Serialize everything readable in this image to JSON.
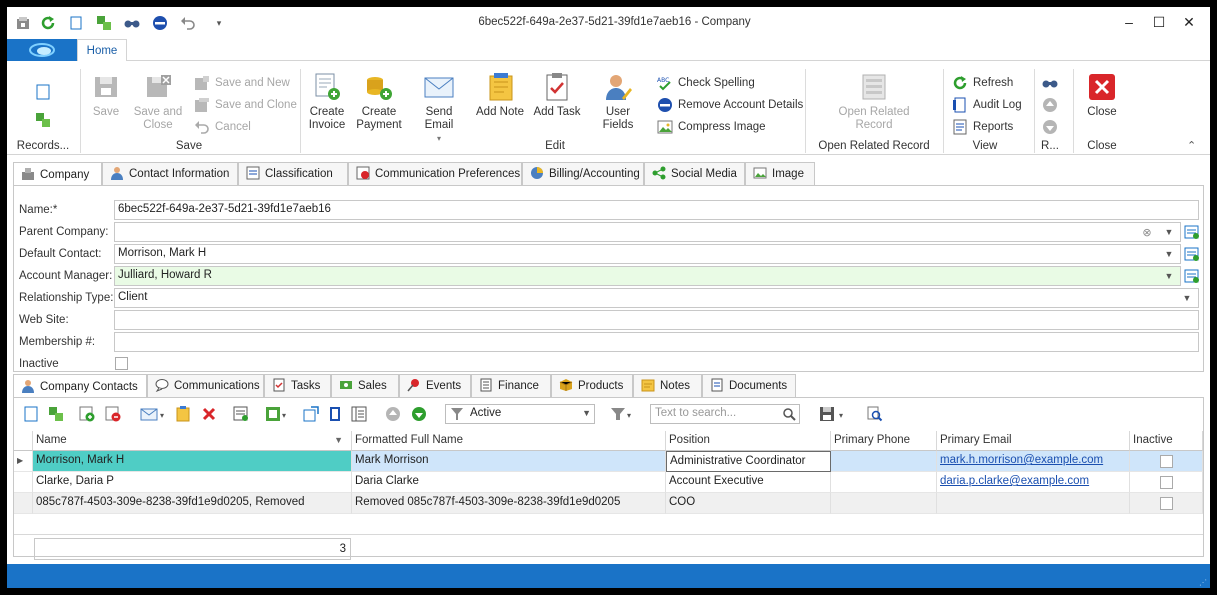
{
  "window": {
    "title": "6bec522f-649a-2e37-5d21-39fd1e7aeb16 - Company",
    "qat_icons": [
      "save-icon",
      "refresh-icon",
      "new-icon",
      "add-green-icon",
      "binoculars-icon",
      "remove-icon",
      "undo-icon",
      "customize-icon"
    ],
    "minimize": "–",
    "maximize": "☐",
    "close": "✕"
  },
  "ribbon": {
    "tab_home": "Home",
    "groups": {
      "records": "Records...",
      "save": "Save",
      "edit": "Edit",
      "open_related": "Open Related Record",
      "view": "View",
      "r": "R...",
      "close": "Close"
    },
    "buttons": {
      "save": "Save",
      "save_and_close_1": "Save and",
      "save_and_close_2": "Close",
      "save_and_new": "Save and New",
      "save_and_clone": "Save and Clone",
      "cancel": "Cancel",
      "create_invoice_1": "Create",
      "create_invoice_2": "Invoice",
      "create_payment_1": "Create",
      "create_payment_2": "Payment",
      "send_email": "Send Email",
      "add_note": "Add Note",
      "add_task": "Add Task",
      "user_fields": "User Fields",
      "check_spelling": "Check Spelling",
      "remove_account_details": "Remove Account Details",
      "compress_image": "Compress Image",
      "open_related_1": "Open Related",
      "open_related_2": "Record",
      "refresh": "Refresh",
      "audit_log": "Audit Log",
      "reports": "Reports",
      "close": "Close"
    },
    "colors": {
      "accent": "#1a73c7",
      "close_red": "#d9262a"
    }
  },
  "form_tabs": [
    "Company",
    "Contact Information",
    "Classification",
    "Communication Preferences",
    "Billing/Accounting",
    "Social Media",
    "Image"
  ],
  "form": {
    "name_label": "Name:*",
    "name_value": "6bec522f-649a-2e37-5d21-39fd1e7aeb16",
    "parent_label": "Parent Company:",
    "parent_value": "",
    "default_contact_label": "Default Contact:",
    "default_contact_value": "Morrison, Mark H",
    "account_manager_label": "Account Manager:",
    "account_manager_value": "Julliard, Howard R",
    "relationship_label": "Relationship Type:",
    "relationship_value": "Client",
    "website_label": "Web Site:",
    "website_value": "",
    "membership_label": "Membership #:",
    "membership_value": "",
    "inactive_label": "Inactive",
    "inactive_checked": false
  },
  "bottom_tabs": [
    "Company Contacts",
    "Communications",
    "Tasks",
    "Sales",
    "Events",
    "Finance",
    "Products",
    "Notes",
    "Documents"
  ],
  "toolbar": {
    "status_filter": "Active",
    "search_placeholder": "Text to search..."
  },
  "grid": {
    "columns": [
      "Name",
      "Formatted Full Name",
      "Position",
      "Primary Phone",
      "Primary Email",
      "Inactive"
    ],
    "rows": [
      {
        "name": "Morrison, Mark H",
        "full_name": "Mark Morrison",
        "position": "Administrative Coordinator",
        "phone": "",
        "email": "mark.h.morrison@example.com",
        "inactive": false
      },
      {
        "name": "Clarke, Daria P",
        "full_name": "Daria Clarke",
        "position": "Account Executive",
        "phone": "",
        "email": "daria.p.clarke@example.com",
        "inactive": false
      },
      {
        "name": "085c787f-4503-309e-8238-39fd1e9d0205, Removed",
        "full_name": "Removed 085c787f-4503-309e-8238-39fd1e9d0205",
        "position": "COO",
        "phone": "",
        "email": "",
        "inactive": false
      }
    ],
    "row_count": "3"
  }
}
